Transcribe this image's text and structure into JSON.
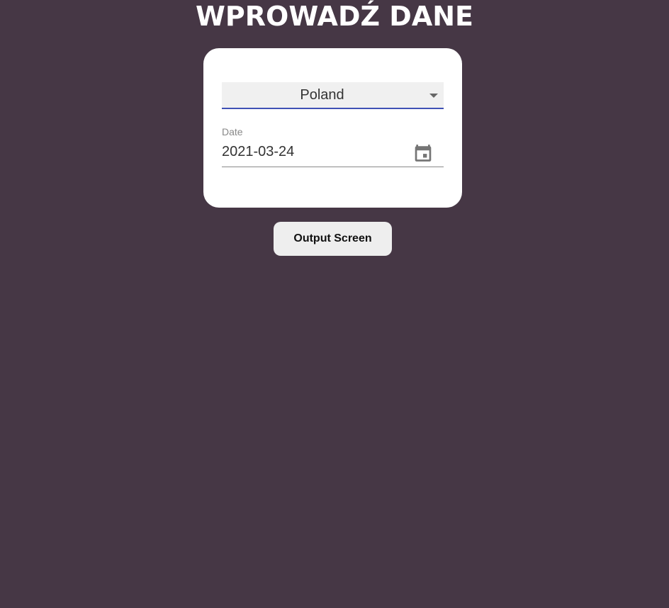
{
  "header": {
    "title": "WPROWADŹ DANE"
  },
  "form": {
    "country_select": {
      "value": "Poland"
    },
    "date": {
      "label": "Date",
      "value": "2021-03-24"
    }
  },
  "actions": {
    "output_button_label": "Output Screen"
  },
  "icons": {
    "select_caret": "chevron-down-icon",
    "date_picker": "calendar-icon"
  },
  "colors": {
    "background": "#463745",
    "card": "#ffffff",
    "select_underline": "#3f51b5",
    "button": "#eeeeee"
  }
}
